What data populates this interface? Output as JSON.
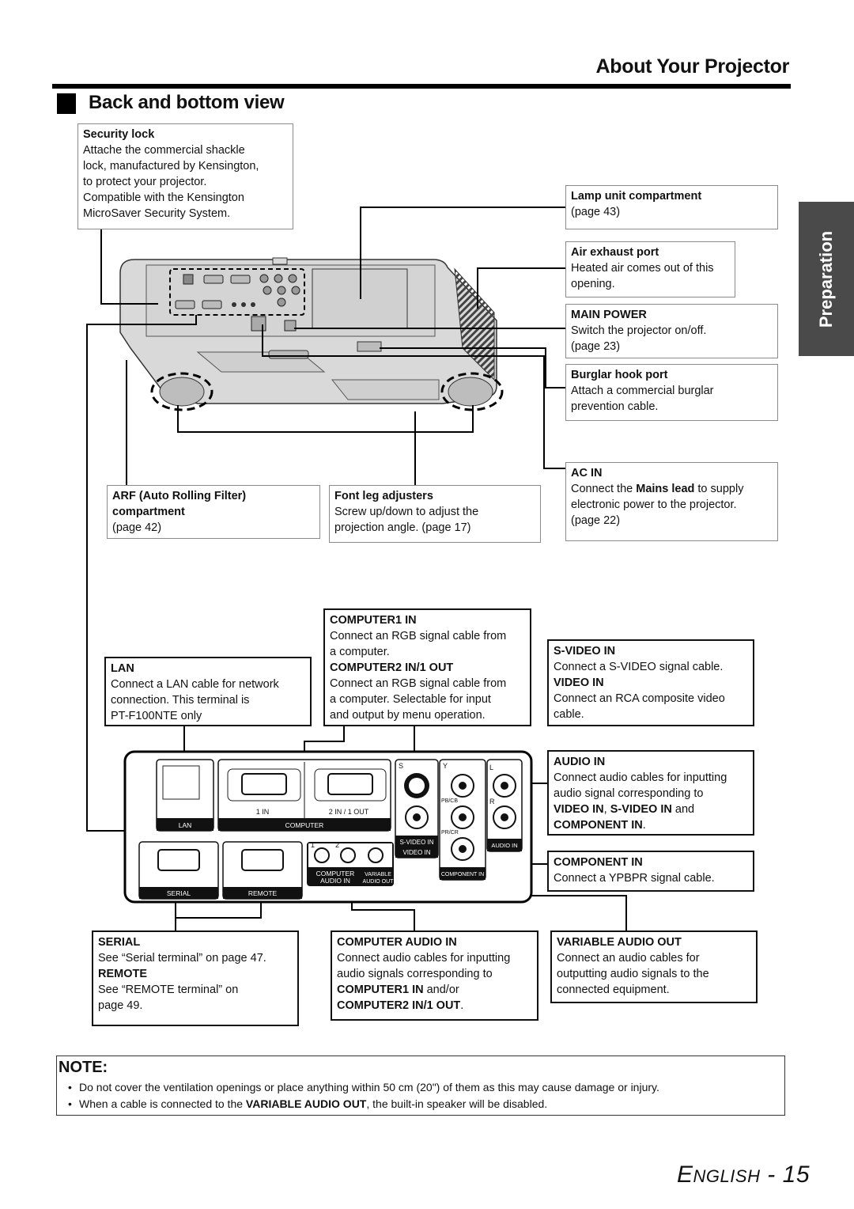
{
  "header": {
    "chapter_title": "About Your Projector"
  },
  "section": {
    "title": "Back and bottom view"
  },
  "side_tab": {
    "label": "Preparation"
  },
  "callouts": {
    "security_lock": {
      "title": "Security lock",
      "lines": [
        "Attache the commercial shackle",
        "lock, manufactured by Kensington,",
        "to protect your projector.",
        "Compatible with the Kensington",
        "MicroSaver Security System."
      ]
    },
    "lamp_unit": {
      "title": "Lamp unit compartment",
      "lines": [
        "(page 43)"
      ]
    },
    "air_exhaust": {
      "title": "Air exhaust port",
      "lines": [
        "Heated air comes out of this",
        "opening."
      ]
    },
    "main_power": {
      "title": "MAIN POWER",
      "lines": [
        "Switch the projector on/off.",
        "(page 23)"
      ]
    },
    "burglar_hook": {
      "title": "Burglar hook port",
      "lines": [
        "Attach a commercial burglar",
        "prevention cable."
      ]
    },
    "ac_in": {
      "title": "AC IN",
      "text_pre": "Connect the ",
      "text_bold": "Mains lead",
      "text_post": " to supply",
      "lines": [
        "electronic power to the projector.",
        "(page 22)"
      ]
    },
    "arf": {
      "title_l1": "ARF (Auto Rolling Filter)",
      "title_l2": "compartment",
      "lines": [
        "(page 42)"
      ]
    },
    "front_leg": {
      "title": "Font leg adjusters",
      "lines": [
        "Screw up/down to adjust the",
        "projection angle. (page 17)"
      ]
    },
    "lan": {
      "title": "LAN",
      "lines": [
        "Connect a LAN cable for network",
        "connection. This terminal is",
        "PT-F100NTE only"
      ]
    },
    "computer": {
      "title1": "COMPUTER1 IN",
      "lines1": [
        "Connect an RGB signal cable from",
        "a computer."
      ],
      "title2": "COMPUTER2 IN/1 OUT",
      "lines2": [
        "Connect an RGB signal cable from",
        "a computer. Selectable for input",
        "and output by menu operation."
      ]
    },
    "svideo": {
      "title1": "S-VIDEO IN",
      "lines1": [
        "Connect a S-VIDEO signal cable."
      ],
      "title2": "VIDEO IN",
      "lines2": [
        "Connect an RCA composite video",
        "cable."
      ]
    },
    "audio_in": {
      "title": "AUDIO IN",
      "lines": [
        "Connect audio cables for inputting",
        "audio signal corresponding to"
      ],
      "bold_a": "VIDEO IN",
      "sep": ", ",
      "bold_b": "S-VIDEO IN",
      "and": " and",
      "bold_c": "COMPONENT IN",
      "end": "."
    },
    "component_in": {
      "title": "COMPONENT IN",
      "line": "Connect a YPBPR signal cable."
    },
    "serial": {
      "title1": "SERIAL",
      "line1": "See “Serial terminal” on page 47.",
      "title2": "REMOTE",
      "lines2": [
        "See “REMOTE terminal” on",
        "page 49."
      ]
    },
    "computer_audio": {
      "title": "COMPUTER AUDIO IN",
      "lines": [
        "Connect audio cables for inputting",
        "audio signals corresponding to"
      ],
      "bold_a": "COMPUTER1 IN",
      "andor": " and/or",
      "bold_b": "COMPUTER2 IN/1 OUT",
      "end": "."
    },
    "variable_audio": {
      "title": "VARIABLE AUDIO OUT",
      "lines": [
        "Connect an audio cables for",
        "outputting audio signals to the",
        "connected equipment."
      ]
    }
  },
  "panel_labels": {
    "lan": "LAN",
    "computer": "COMPUTER",
    "in1": "1 IN",
    "in2": "2 IN / 1 OUT",
    "serial": "SERIAL",
    "remote": "REMOTE",
    "s": "S",
    "y": "Y",
    "l": "L",
    "r": "R",
    "pbcb": "PB/CB",
    "prcr": "PR/CR",
    "svideo_in": "S-VIDEO IN",
    "video_in": "VIDEO IN",
    "component_in": "COMPONENT IN",
    "audio_in": "AUDIO IN",
    "one": "1",
    "two": "2",
    "computer_audio_l1": "COMPUTER",
    "computer_audio_l2": "AUDIO IN",
    "variable_l1": "VARIABLE",
    "variable_l2": "AUDIO OUT"
  },
  "note": {
    "title": "NOTE:",
    "items": [
      {
        "text": "Do not cover the ventilation openings or place anything within 50 cm (20\") of them as this may cause damage or injury."
      },
      {
        "pre": "When a cable is connected to the ",
        "bold": "VARIABLE AUDIO OUT",
        "post": ", the built-in speaker will be disabled."
      }
    ]
  },
  "footer": {
    "lang_first": "E",
    "lang_rest": "NGLISH",
    "page": " - 15"
  }
}
